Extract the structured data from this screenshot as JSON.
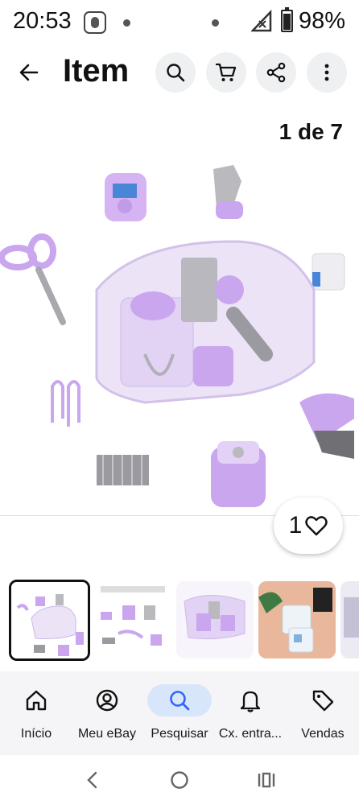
{
  "status_bar": {
    "time": "20:53",
    "battery": "98%"
  },
  "app_bar": {
    "title": "Item",
    "icons": [
      "back-arrow-icon",
      "search-icon",
      "cart-icon",
      "share-icon",
      "more-vert-icon"
    ]
  },
  "gallery": {
    "counter": "1 de 7",
    "watch_count": "1"
  },
  "thumbnails": [
    {
      "label": "thumbnail-1",
      "selected": true
    },
    {
      "label": "thumbnail-2",
      "selected": false
    },
    {
      "label": "thumbnail-3",
      "selected": false
    },
    {
      "label": "thumbnail-4",
      "selected": false
    },
    {
      "label": "thumbnail-5",
      "selected": false
    }
  ],
  "bottom_nav": {
    "items": [
      {
        "label": "Início",
        "icon": "home-icon"
      },
      {
        "label": "Meu eBay",
        "icon": "profile-icon"
      },
      {
        "label": "Pesquisar",
        "icon": "search-icon",
        "active": true
      },
      {
        "label": "Cx. entra...",
        "icon": "bell-icon"
      },
      {
        "label": "Vendas",
        "icon": "tag-icon"
      }
    ]
  },
  "colors": {
    "accent_purple": "#c9a6ee",
    "nav_active_bg": "#d7e6fb",
    "nav_active_icon": "#3665f3"
  }
}
